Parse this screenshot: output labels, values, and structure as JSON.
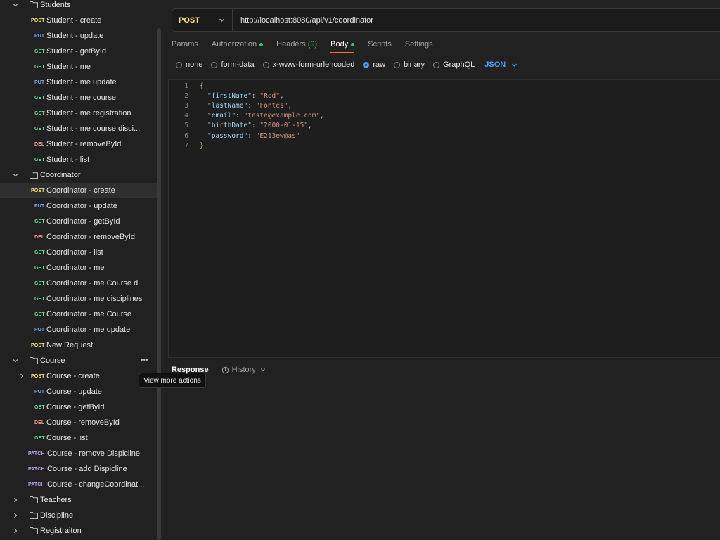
{
  "sidebar": {
    "rows": [
      {
        "type": "folder",
        "label": "Students",
        "expanded": true,
        "chevron": "chevron-down-icon"
      },
      {
        "type": "request",
        "method": "POST",
        "label": "Student - create"
      },
      {
        "type": "request",
        "method": "PUT",
        "label": "Student - update"
      },
      {
        "type": "request",
        "method": "GET",
        "label": "Student - getById"
      },
      {
        "type": "request",
        "method": "GET",
        "label": "Student - me"
      },
      {
        "type": "request",
        "method": "PUT",
        "label": "Student - me update"
      },
      {
        "type": "request",
        "method": "GET",
        "label": "Student - me course"
      },
      {
        "type": "request",
        "method": "GET",
        "label": "Student - me registration"
      },
      {
        "type": "request",
        "method": "GET",
        "label": "Student - me course disci..."
      },
      {
        "type": "request",
        "method": "DEL",
        "label": "Student - removeById"
      },
      {
        "type": "request",
        "method": "GET",
        "label": "Student - list"
      },
      {
        "type": "folder",
        "label": "Coordinator",
        "expanded": true,
        "chevron": "chevron-down-icon"
      },
      {
        "type": "request",
        "method": "POST",
        "label": "Coordinator - create",
        "selected": true
      },
      {
        "type": "request",
        "method": "PUT",
        "label": "Coordinator - update"
      },
      {
        "type": "request",
        "method": "GET",
        "label": "Coordinator - getById"
      },
      {
        "type": "request",
        "method": "DEL",
        "label": "Coordinator - removeById"
      },
      {
        "type": "request",
        "method": "GET",
        "label": "Coordinator - list"
      },
      {
        "type": "request",
        "method": "GET",
        "label": "Coordinator - me"
      },
      {
        "type": "request",
        "method": "GET",
        "label": "Coordinator - me Course d..."
      },
      {
        "type": "request",
        "method": "GET",
        "label": "Coordinator - me disciplines"
      },
      {
        "type": "request",
        "method": "GET",
        "label": "Coordinator - me Course"
      },
      {
        "type": "request",
        "method": "PUT",
        "label": "Coordinator - me update"
      },
      {
        "type": "request",
        "method": "POST",
        "label": "New Request"
      },
      {
        "type": "folder",
        "label": "Course",
        "expanded": true,
        "chevron": "chevron-down-icon",
        "more": true
      },
      {
        "type": "request",
        "method": "POST",
        "label": "Course - create",
        "chevron": "chevron-right-icon"
      },
      {
        "type": "request",
        "method": "PUT",
        "label": "Course - update"
      },
      {
        "type": "request",
        "method": "GET",
        "label": "Course - getById"
      },
      {
        "type": "request",
        "method": "DEL",
        "label": "Course - removeById"
      },
      {
        "type": "request",
        "method": "GET",
        "label": "Course - list"
      },
      {
        "type": "request",
        "method": "PATCH",
        "label": "Course - remove Dispicline"
      },
      {
        "type": "request",
        "method": "PATCH",
        "label": "Course - add Dispicline"
      },
      {
        "type": "request",
        "method": "PATCH",
        "label": "Course - changeCoordinat..."
      },
      {
        "type": "folder",
        "label": "Teachers",
        "expanded": false,
        "chevron": "chevron-right-icon"
      },
      {
        "type": "folder",
        "label": "Discipline",
        "expanded": false,
        "chevron": "chevron-right-icon"
      },
      {
        "type": "folder",
        "label": "Registraiton",
        "expanded": false,
        "chevron": "chevron-right-icon"
      }
    ],
    "more_glyph": "•••",
    "tooltip": "View more actions"
  },
  "request": {
    "method": "POST",
    "url": "http://localhost:8080/api/v1/coordinator"
  },
  "tabs": {
    "params": "Params",
    "authorization": "Authorization",
    "headers": "Headers",
    "headers_count": "(9)",
    "body": "Body",
    "scripts": "Scripts",
    "settings": "Settings"
  },
  "body_types": {
    "none": "none",
    "form_data": "form-data",
    "urlencoded": "x-www-form-urlencoded",
    "raw": "raw",
    "binary": "binary",
    "graphql": "GraphQL",
    "language": "JSON",
    "selected": "raw"
  },
  "editor": {
    "lines": [
      {
        "n": "1",
        "text": "{"
      },
      {
        "n": "2",
        "key": "\"firstName\"",
        "value": "\"Rod\"",
        "end": ","
      },
      {
        "n": "3",
        "key": "\"lastName\"",
        "value": "\"Fontes\"",
        "end": ","
      },
      {
        "n": "4",
        "key": "\"email\"",
        "value": "\"teste@example.com\"",
        "end": ","
      },
      {
        "n": "5",
        "key": "\"birthDate\"",
        "value": "\"2000-01-15\"",
        "end": ","
      },
      {
        "n": "6",
        "key": "\"password\"",
        "value": "\"E213ew@as\"",
        "end": ""
      },
      {
        "n": "7",
        "text": "}"
      }
    ]
  },
  "response": {
    "tab": "Response",
    "history": "History"
  },
  "colors": {
    "get": "#6bdd9a",
    "post": "#ffe47e",
    "put": "#74aef6",
    "del": "#f79a8e",
    "patch": "#c0a8e1",
    "active_tab": "#ff6c37",
    "accent": "#4d9ef7"
  }
}
